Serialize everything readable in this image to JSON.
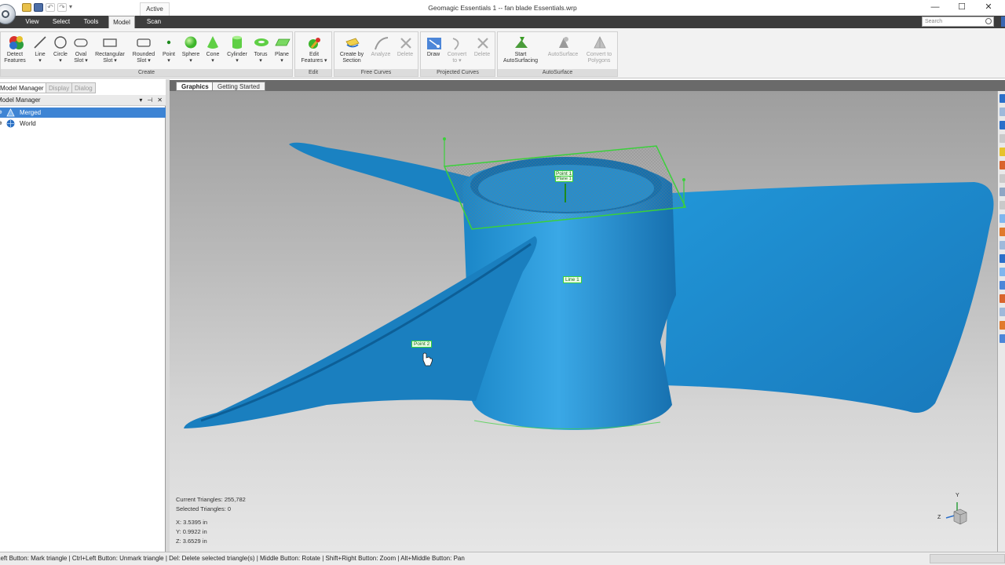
{
  "window": {
    "title": "Geomagic Essentials 1 -- fan blade Essentials.wrp",
    "active_tab": "Active",
    "controls": {
      "minimize": "—",
      "maximize": "☐",
      "close": "✕"
    }
  },
  "menu_tabs": [
    "View",
    "Select",
    "Tools",
    "Model",
    "Scan"
  ],
  "search": {
    "placeholder": "Search"
  },
  "ribbon": {
    "groups": {
      "create": "Create",
      "edit": "Edit",
      "free_curves": "Free Curves",
      "projected_curves": "Projected Curves",
      "autosurface": "AutoSurface"
    },
    "buttons": {
      "detect_features": "Detect\nFeatures",
      "line": "Line\n▾",
      "circle": "Circle\n▾",
      "oval_slot": "Oval\nSlot ▾",
      "rectangular_slot": "Rectangular\nSlot ▾",
      "rounded_slot": "Rounded\nSlot ▾",
      "point": "Point\n▾",
      "sphere": "Sphere\n▾",
      "cone": "Cone\n▾",
      "cylinder": "Cylinder\n▾",
      "torus": "Torus\n▾",
      "plane": "Plane\n▾",
      "edit_features": "Edit\nFeatures ▾",
      "create_by_section": "Create by\nSection",
      "analyze": "Analyze",
      "delete_free": "Delete",
      "draw": "Draw",
      "convert_to": "Convert\nto ▾",
      "delete_projected": "Delete",
      "start_autosurfacing": "Start\nAutoSurfacing",
      "autosurface": "AutoSurface",
      "convert_to_polygons": "Convert to\nPolygons"
    }
  },
  "left_pane": {
    "tabs": [
      "Model Manager",
      "Display",
      "Dialog"
    ],
    "header": "Model Manager",
    "header_buttons": [
      "▾",
      "⊣",
      "✕"
    ],
    "tree": [
      {
        "label": "Merged",
        "selected": true
      },
      {
        "label": "World",
        "selected": false
      }
    ]
  },
  "doc_tabs": [
    "Graphics",
    "Getting Started"
  ],
  "viewport": {
    "labels": {
      "point1": "Point 1",
      "plane1": "Plane 1",
      "line1": "Line 1",
      "point2": "Point 2"
    },
    "stats": {
      "current_triangles": "Current Triangles: 255,782",
      "selected_triangles": "Selected Triangles: 0",
      "x": "X:  3.5395 in",
      "y": "Y:  0.9922 in",
      "z": "Z:  3.6529 in"
    },
    "axis_labels": {
      "y": "Y",
      "z": "Z"
    },
    "colors": {
      "model": "#1f8fd0",
      "feature": "#3ad13a"
    }
  },
  "status_bar": {
    "text": "Left Button: Mark triangle | Ctrl+Left Button: Unmark triangle | Del: Delete selected triangle(s) | Middle Button: Rotate | Shift+Right Button: Zoom | Alt+Middle Button: Pan"
  }
}
